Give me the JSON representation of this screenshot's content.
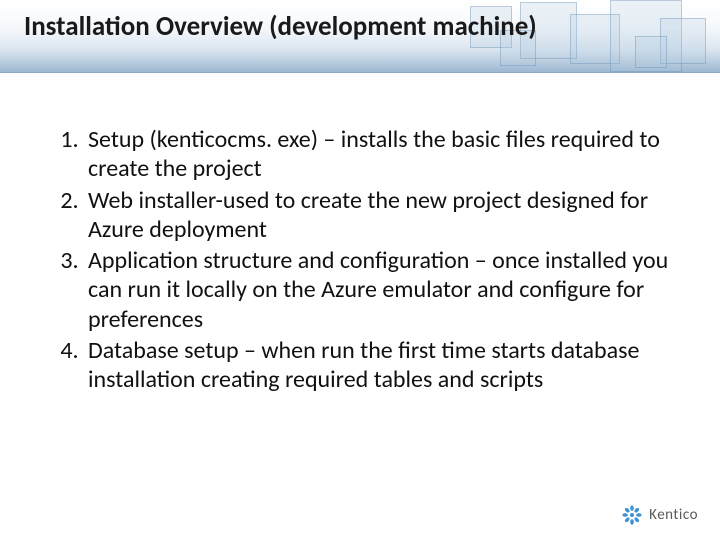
{
  "header": {
    "title": "Installation Overview (development machine)"
  },
  "list": {
    "items": [
      "Setup (kenticocms. exe) – installs the basic files required to create the project",
      "Web installer-used to create the new project designed for Azure deployment",
      "Application structure and configuration – once installed you can run it locally on the Azure emulator and configure for preferences",
      "Database setup – when run the first time starts database installation creating required tables and scripts"
    ]
  },
  "footer": {
    "brand": "Kentico"
  }
}
